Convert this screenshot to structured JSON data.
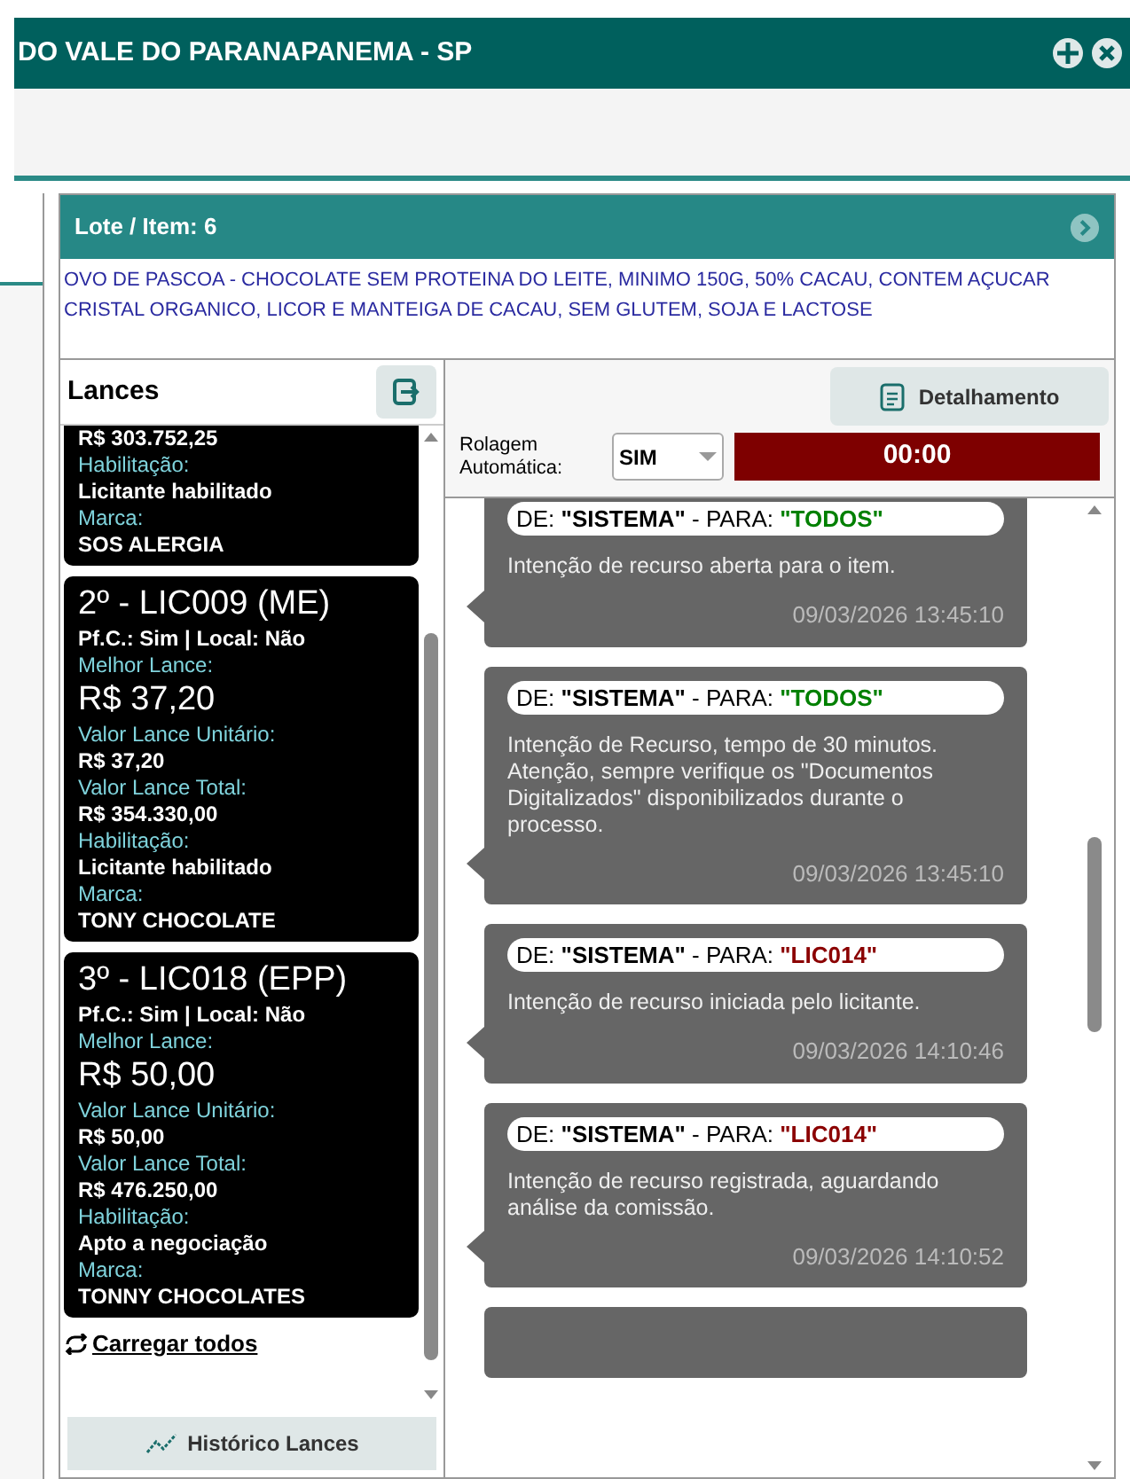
{
  "window": {
    "title": "DO VALE DO PARANAPANEMA - SP"
  },
  "lote": {
    "title": "Lote / Item: 6",
    "description": "OVO DE PASCOA - CHOCOLATE SEM PROTEINA DO LEITE, MINIMO 150G, 50% CACAU, CONTEM AÇUCAR CRISTAL ORGANICO, LICOR E MANTEIGA DE CACAU, SEM GLUTEM, SOJA E LACTOSE"
  },
  "lances": {
    "title": "Lances",
    "load_all": "Carregar todos",
    "history_button": "Histórico Lances",
    "cards": [
      {
        "lines": [
          {
            "kind": "value",
            "text": "R$ 303.752,25"
          },
          {
            "kind": "label",
            "text": "Habilitação:"
          },
          {
            "kind": "value",
            "text": "Licitante habilitado"
          },
          {
            "kind": "label",
            "text": "Marca:"
          },
          {
            "kind": "value",
            "text": "SOS ALERGIA"
          }
        ]
      },
      {
        "lines": [
          {
            "kind": "title",
            "text": "2º - LIC009 (ME)"
          },
          {
            "kind": "value",
            "text": "Pf.C.: Sim | Local: Não"
          },
          {
            "kind": "label",
            "text": "Melhor Lance:"
          },
          {
            "kind": "big",
            "text": "R$ 37,20"
          },
          {
            "kind": "label",
            "text": "Valor Lance Unitário:"
          },
          {
            "kind": "value",
            "text": "R$ 37,20"
          },
          {
            "kind": "label",
            "text": "Valor Lance Total:"
          },
          {
            "kind": "value",
            "text": "R$ 354.330,00"
          },
          {
            "kind": "label",
            "text": "Habilitação:"
          },
          {
            "kind": "value",
            "text": "Licitante habilitado"
          },
          {
            "kind": "label",
            "text": "Marca:"
          },
          {
            "kind": "value",
            "text": "TONY CHOCOLATE"
          }
        ]
      },
      {
        "lines": [
          {
            "kind": "title",
            "text": "3º - LIC018 (EPP)"
          },
          {
            "kind": "value",
            "text": "Pf.C.: Sim | Local: Não"
          },
          {
            "kind": "label",
            "text": "Melhor Lance:"
          },
          {
            "kind": "big",
            "text": "R$ 50,00"
          },
          {
            "kind": "label",
            "text": "Valor Lance Unitário:"
          },
          {
            "kind": "value",
            "text": "R$ 50,00"
          },
          {
            "kind": "label",
            "text": "Valor Lance Total:"
          },
          {
            "kind": "value",
            "text": "R$ 476.250,00"
          },
          {
            "kind": "label",
            "text": "Habilitação:"
          },
          {
            "kind": "value",
            "text": "Apto a negociação"
          },
          {
            "kind": "label",
            "text": "Marca:"
          },
          {
            "kind": "value",
            "text": "TONNY CHOCOLATES"
          }
        ]
      }
    ]
  },
  "chat": {
    "detail_button": "Detalhamento",
    "autoscroll_label": "Rolagem Automática:",
    "autoscroll_value": "SIM",
    "timer": "00:00",
    "messages": [
      {
        "prefix": "DE: ",
        "from": "\"SISTEMA\"",
        "middle": " - PARA: ",
        "to": "\"TODOS\"",
        "color": "#008000",
        "text": "Intenção de recurso aberta para o item.",
        "time": "09/03/2026 13:45:10"
      },
      {
        "prefix": "DE: ",
        "from": "\"SISTEMA\"",
        "middle": " - PARA: ",
        "to": "\"TODOS\"",
        "color": "#008000",
        "text": "Intenção de Recurso, tempo de 30 minutos. Atenção, sempre verifique os \"Documentos Digitalizados\" disponibilizados durante o processo.",
        "time": "09/03/2026 13:45:10"
      },
      {
        "prefix": "DE: ",
        "from": "\"SISTEMA\"",
        "middle": " - PARA: ",
        "to": "\"LIC014\"",
        "color": "#8b0000",
        "text": "Intenção de recurso iniciada pelo licitante.",
        "time": "09/03/2026 14:10:46"
      },
      {
        "prefix": "DE: ",
        "from": "\"SISTEMA\"",
        "middle": " - PARA: ",
        "to": "\"LIC014\"",
        "color": "#8b0000",
        "text": "Intenção de recurso registrada, aguardando análise da comissão.",
        "time": "09/03/2026 14:10:52"
      }
    ]
  }
}
